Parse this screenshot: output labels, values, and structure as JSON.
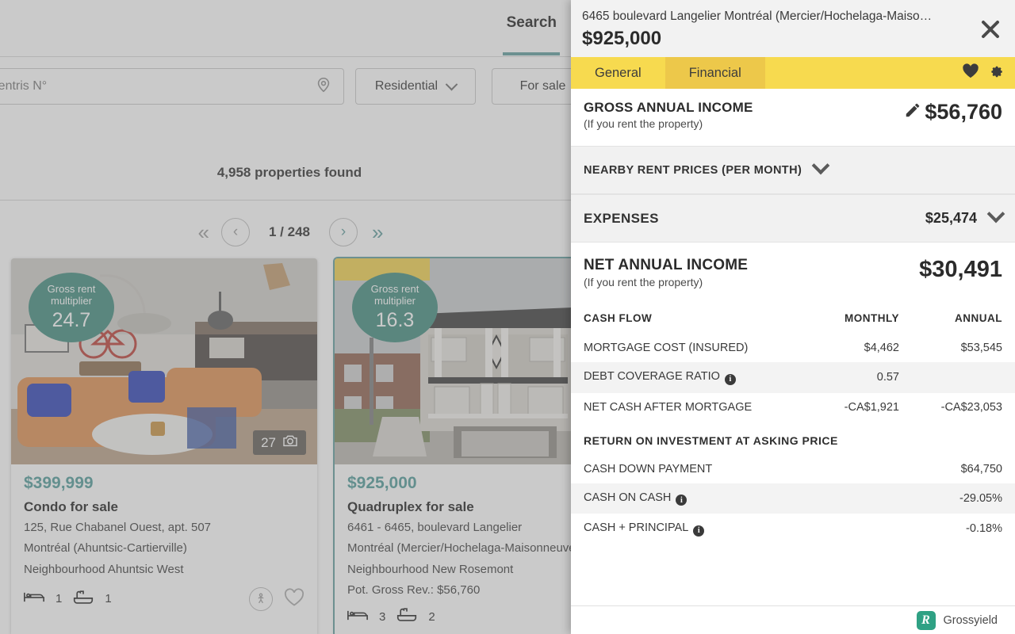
{
  "search_app": {
    "tab_label": "Search",
    "search_input_value": "",
    "search_input_placeholder": "s or Centris N°",
    "filters": [
      {
        "label": "Residential"
      },
      {
        "label": "For sale"
      }
    ],
    "results_count_text": "4,958 properties found",
    "pagination": {
      "first_label": "«",
      "prev_label": "‹",
      "page_label": "1 / 248",
      "next_label": "›",
      "last_label": "»"
    },
    "cards": [
      {
        "grm_label_line1": "Gross rent",
        "grm_label_line2": "multiplier",
        "grm_value": "24.7",
        "photo_count": "27",
        "price": "$399,999",
        "type": "Condo for sale",
        "address_line1": "125, Rue Chabanel Ouest, apt. 507",
        "address_line2": "Montréal (Ahuntsic-Cartierville)",
        "address_line3": "Neighbourhood Ahuntsic West",
        "address_line4": "",
        "bedrooms": "1",
        "bathrooms": "1"
      },
      {
        "grm_label_line1": "Gross rent",
        "grm_label_line2": "multiplier",
        "grm_value": "16.3",
        "photo_count": "",
        "price": "$925,000",
        "type": "Quadruplex for sale",
        "address_line1": "6461 - 6465, boulevard Langelier",
        "address_line2": "Montréal (Mercier/Hochelaga-Maisonneuve)",
        "address_line3": "Neighbourhood New Rosemont",
        "address_line4": "Pot. Gross Rev.: $56,760",
        "bedrooms": "3",
        "bathrooms": "2"
      }
    ]
  },
  "panel": {
    "address": "6465 boulevard Langelier Montréal (Mercier/Hochelaga-Maiso…",
    "price": "$925,000",
    "close_label": "✕",
    "tabs": [
      {
        "label": "General",
        "active": false
      },
      {
        "label": "Financial",
        "active": true
      }
    ],
    "gross_annual_income": {
      "label": "GROSS ANNUAL INCOME",
      "sublabel": "(If you rent the property)",
      "value": "$56,760"
    },
    "nearby_rent_prices": {
      "label": "NEARBY RENT PRICES (PER MONTH)"
    },
    "expenses": {
      "label": "EXPENSES",
      "value": "$25,474"
    },
    "net_annual_income": {
      "label": "NET ANNUAL INCOME",
      "sublabel": "(If you rent the property)",
      "value": "$30,491"
    },
    "cash_flow": {
      "header_label": "CASH FLOW",
      "header_monthly": "MONTHLY",
      "header_annual": "ANNUAL",
      "rows": [
        {
          "label": "MORTGAGE COST (INSURED)",
          "info": false,
          "monthly": "$4,462",
          "annual": "$53,545"
        },
        {
          "label": "DEBT COVERAGE RATIO",
          "info": true,
          "monthly": "0.57",
          "annual": ""
        },
        {
          "label": "NET CASH AFTER MORTGAGE",
          "info": false,
          "monthly": "-CA$1,921",
          "annual": "-CA$23,053"
        }
      ]
    },
    "roi": {
      "header_label": "RETURN ON INVESTMENT AT ASKING PRICE",
      "rows": [
        {
          "label": "CASH DOWN PAYMENT",
          "info": false,
          "value": "$64,750"
        },
        {
          "label": "CASH ON CASH",
          "info": true,
          "value": "-29.05%"
        },
        {
          "label": "CASH + PRINCIPAL",
          "info": true,
          "value": "-0.18%"
        }
      ]
    },
    "footer": {
      "logo_letter": "R",
      "brand": "Grossyield"
    }
  },
  "colors": {
    "tab_yellow": "#f7da4f",
    "tab_yellow_active": "#edc84a",
    "teal": "#4f9a98",
    "badge_green": "#3f8a7d",
    "brand_green": "#2fa184"
  }
}
